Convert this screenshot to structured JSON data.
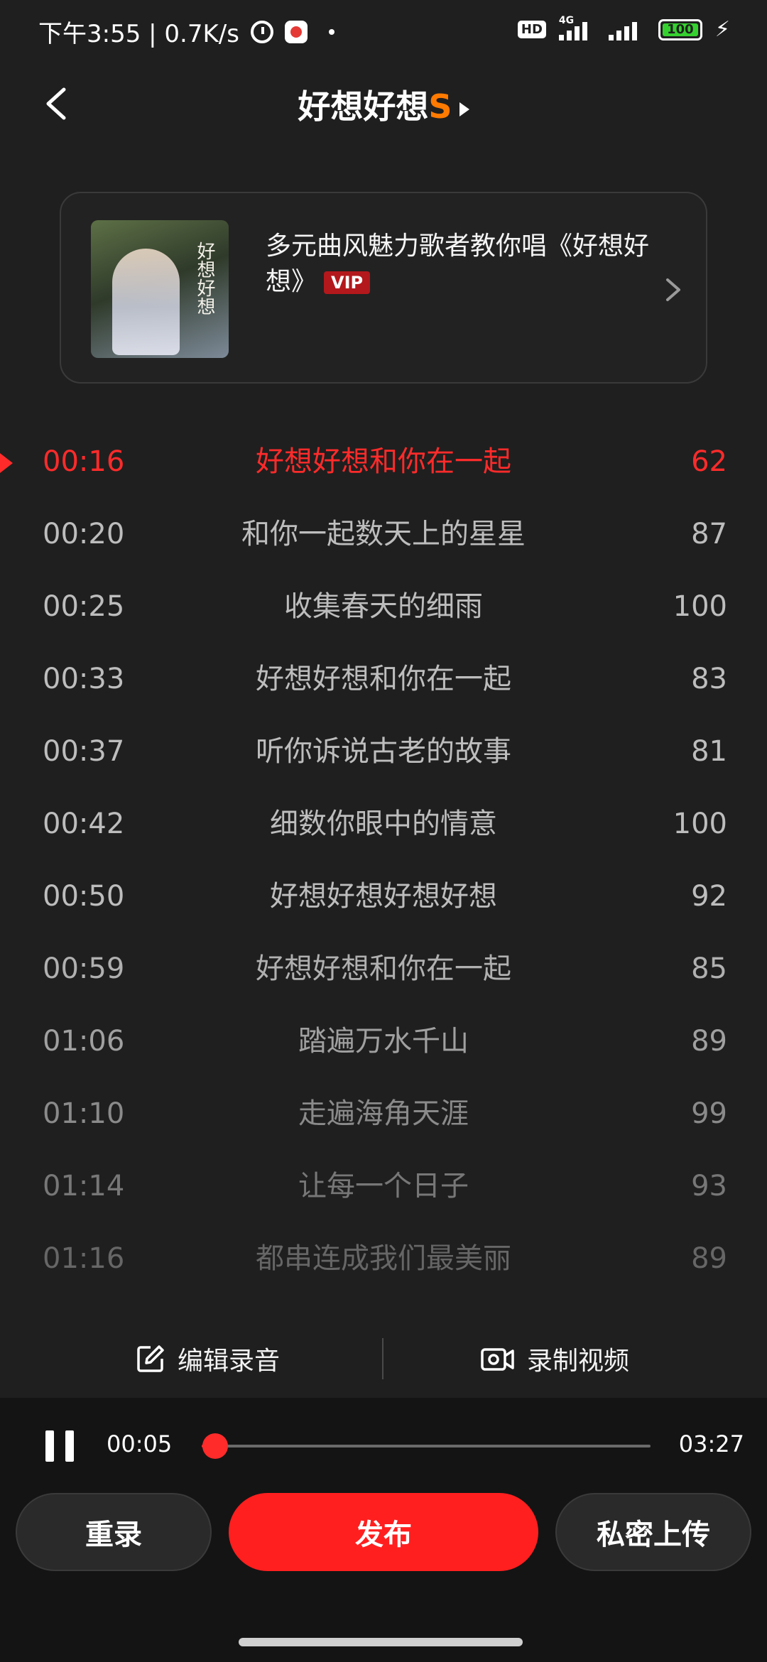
{
  "status_bar": {
    "time_speed": "下午3:55 | 0.7K/s",
    "hd": "HD",
    "network": "4G",
    "battery": "100"
  },
  "header": {
    "title": "好想好想",
    "title_badge": "S"
  },
  "course_card": {
    "cover_text": "好想好想",
    "title": "多元曲风魅力歌者教你唱《好想好想》",
    "badge": "VIP"
  },
  "lyrics": [
    {
      "time": "00:16",
      "text": "好想好想和你在一起",
      "score": "62",
      "active": true
    },
    {
      "time": "00:20",
      "text": "和你一起数天上的星星",
      "score": "87"
    },
    {
      "time": "00:25",
      "text": "收集春天的细雨",
      "score": "100"
    },
    {
      "time": "00:33",
      "text": "好想好想和你在一起",
      "score": "83"
    },
    {
      "time": "00:37",
      "text": "听你诉说古老的故事",
      "score": "81"
    },
    {
      "time": "00:42",
      "text": "细数你眼中的情意",
      "score": "100"
    },
    {
      "time": "00:50",
      "text": "好想好想好想好想",
      "score": "92"
    },
    {
      "time": "00:59",
      "text": "好想好想和你在一起",
      "score": "85"
    },
    {
      "time": "01:06",
      "text": "踏遍万水千山",
      "score": "89"
    },
    {
      "time": "01:10",
      "text": "走遍海角天涯",
      "score": "99"
    },
    {
      "time": "01:14",
      "text": "让每一个日子",
      "score": "93"
    },
    {
      "time": "01:16",
      "text": "都串连成我们最美丽",
      "score": "89"
    }
  ],
  "actions": {
    "edit_label": "编辑录音",
    "video_label": "录制视频"
  },
  "player": {
    "current_time": "00:05",
    "total_time": "03:27",
    "progress": 0.03
  },
  "buttons": {
    "rerecord": "重录",
    "publish": "发布",
    "private_upload": "私密上传"
  },
  "colors": {
    "accent": "#ff2b2b",
    "badge_orange": "#ff7a00",
    "background": "#1f1f1f"
  }
}
